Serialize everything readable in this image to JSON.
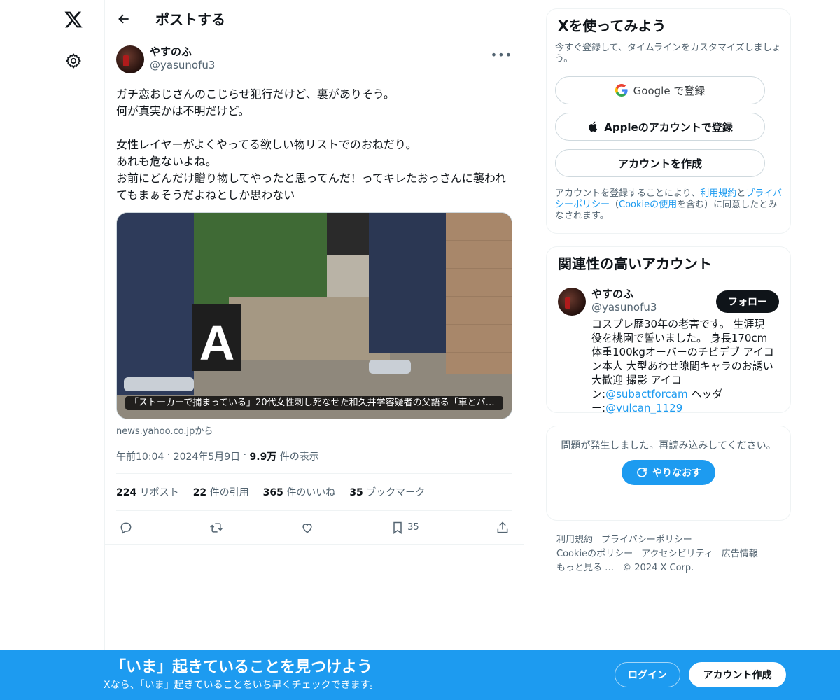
{
  "header": {
    "title": "ポストする"
  },
  "post": {
    "author_name": "やすのふ",
    "author_handle": "@yasunofu3",
    "text": "ガチ恋おじさんのこじらせ犯行だけど、裏がありそう。\n何が真実かは不明だけど。\n\n女性レイヤーがよくやってる欲しい物リストでのおねだり。\nあれも危ないよね。\nお前にどんだけ贈り物してやったと思ってんだ！ってキレたおっさんに襲われてもまぁそうだよねとしか思わない",
    "media_caption": "「ストーカーで捕まっている」20代女性刺し死なせた和久井学容疑者の父語る「車とバイ…",
    "media_source": "news.yahoo.co.jpから",
    "time": "午前10:04",
    "date": "2024年5月9日",
    "views_count": "9.9万",
    "views_label": "件の表示",
    "reposts_count": "224",
    "reposts_label": "リポスト",
    "quotes_count": "22",
    "quotes_label": "件の引用",
    "likes_count": "365",
    "likes_label": "件のいいね",
    "bookmarks_count": "35",
    "bookmarks_label": "ブックマーク",
    "bookmark_action_count": "35"
  },
  "signup": {
    "title": "Xを使ってみよう",
    "subtitle": "今すぐ登録して、タイムラインをカスタマイズしましょう。",
    "google_label": "Google で登録",
    "apple_label": "Appleのアカウントで登録",
    "create_label": "アカウントを作成",
    "legal_1": "アカウントを登録することにより、",
    "legal_terms": "利用規約",
    "legal_2": "と",
    "legal_privacy": "プライバシーポリシー",
    "legal_3": "（",
    "legal_cookie": "Cookieの使用",
    "legal_4": "を含む）に同意したとみなされます。"
  },
  "related": {
    "title": "関連性の高いアカウント",
    "name": "やすのふ",
    "handle": "@yasunofu3",
    "follow_label": "フォロー",
    "bio_1": "コスプレ歴30年の老害です。 生涯現役を桃園で誓いました。 身長170cm 体重100kgオーバーのチビデブ アイコン本人 大型あわせ隙間キャラのお誘い大歓迎 撮影 アイコン:",
    "bio_link_1": "@subactforcam",
    "bio_2": " ヘッダー:",
    "bio_link_2": "@vulcan_1129"
  },
  "error": {
    "text": "問題が発生しました。再読み込みしてください。",
    "retry_label": "やりなおす"
  },
  "footer": {
    "links": [
      "利用規約",
      "プライバシーポリシー",
      "Cookieのポリシー",
      "アクセシビリティ",
      "広告情報",
      "もっと見る …",
      "© 2024 X Corp."
    ]
  },
  "bottom_bar": {
    "title": "「いま」起きていることを見つけよう",
    "subtitle": "Xなら、「いま」起きていることをいち早くチェックできます。",
    "login_label": "ログイン",
    "signup_label": "アカウント作成"
  },
  "colors": {
    "accent": "#1d9bf0",
    "text": "#0f1419",
    "secondary": "#536471"
  },
  "icons": [
    "x-logo-icon",
    "gear-icon",
    "back-arrow-icon",
    "more-icon",
    "reply-icon",
    "repost-icon",
    "like-icon",
    "bookmark-icon",
    "share-icon",
    "google-icon",
    "apple-icon",
    "refresh-icon"
  ]
}
